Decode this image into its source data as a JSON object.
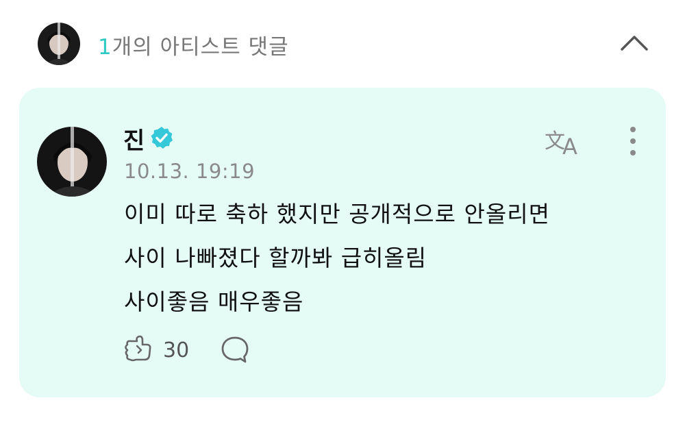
{
  "header": {
    "count": "1",
    "title": "개의 아티스트 댓글"
  },
  "comment": {
    "author": "진",
    "timestamp": "10.13. 19:19",
    "lines": [
      "이미 따로 축하 했지만 공개적으로 안올리면",
      "사이 나빠졌다 할까봐 급히올림",
      "사이좋음 매우좋음"
    ],
    "likes": "30"
  },
  "icons": {
    "collapse": "chevron-up-icon",
    "verified": "verified-badge-icon",
    "translate": "translate-icon",
    "more": "more-vertical-icon",
    "like": "like-icon",
    "reply": "reply-icon"
  },
  "colors": {
    "accent": "#2ec9c2",
    "card_background": "#e5fbf6",
    "verified": "#34c8d8"
  }
}
